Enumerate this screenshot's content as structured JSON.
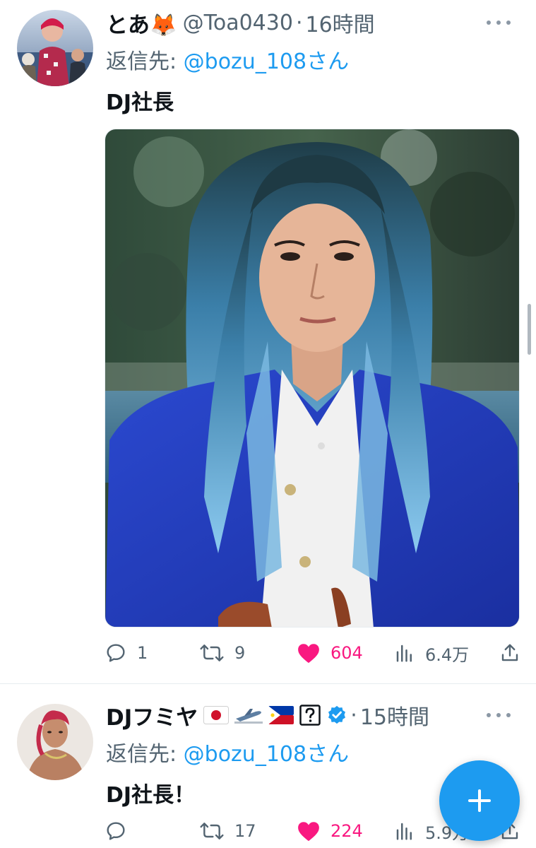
{
  "tweets": [
    {
      "display_name": "とあ🦊",
      "handle": "@Toa0430",
      "separator": "·",
      "time": "16時間",
      "reply_prefix": "返信先: ",
      "reply_to": "@bozu_108さん",
      "text": "DJ社長",
      "media_alt": "photo-portrait",
      "stats": {
        "replies": "1",
        "retweets": "9",
        "likes": "604",
        "views": "6.4万"
      }
    },
    {
      "display_name": "DJフミヤ",
      "name_badges": [
        "japan-flag",
        "airplane",
        "philippines-flag",
        "question-mark-box"
      ],
      "verified": true,
      "separator": "·",
      "time": "15時間",
      "reply_prefix": "返信先: ",
      "reply_to": "@bozu_108さん",
      "text": "DJ社長！",
      "stats": {
        "replies": "",
        "retweets": "17",
        "likes": "224",
        "views": "5.9万"
      }
    }
  ],
  "colors": {
    "accent": "#1d9bf0",
    "like": "#f91880",
    "secondary_text": "#536471"
  },
  "fab": {
    "icon": "plus-icon"
  }
}
